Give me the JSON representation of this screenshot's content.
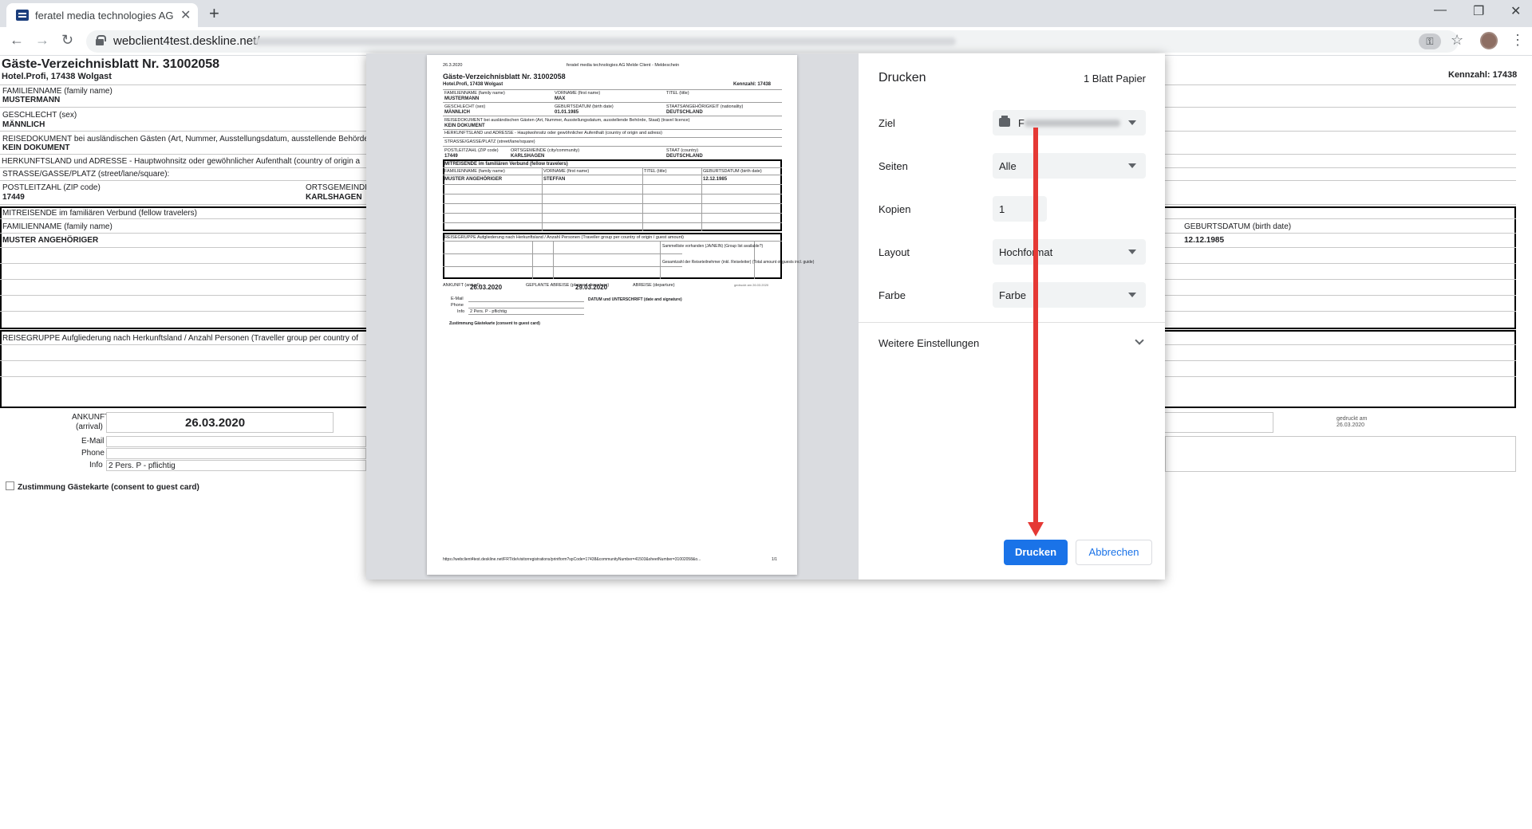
{
  "browser": {
    "tab_title": "feratel media technologies AG M",
    "tab_close": "✕",
    "new_tab": "+",
    "url": "webclient4test.deskline.net/",
    "back": "←",
    "forward": "→",
    "reload": "↻",
    "minimize": "—",
    "restore": "❐",
    "close": "✕",
    "star": "☆",
    "key_icon": "⚿",
    "menu": "⋮"
  },
  "form": {
    "title": "Gäste-Verzeichnisblatt Nr. 31002058",
    "hotel": "Hotel.Profi, 17438 Wolgast",
    "kennzahl": "Kennzahl: 17438",
    "familienname_label": "FAMILIENNAME (family name)",
    "familienname_value": "MUSTERMANN",
    "geschlecht_label": "GESCHLECHT (sex)",
    "geschlecht_value": "MÄNNLICH",
    "reisedokument_label": "REISEDOKUMENT bei ausländischen Gästen (Art, Nummer, Ausstellungsdatum, ausstellende Behörde",
    "reisedokument_value": "KEIN DOKUMENT",
    "herkunft_label": "HERKUNFTSLAND und ADRESSE - Hauptwohnsitz oder gewöhnlicher Aufenthalt (country of origin a",
    "strasse_label": "STRASSE/GASSE/PLATZ (street/lane/square):",
    "plz_label": "POSTLEITZAHL (ZIP code)",
    "plz_value": "17449",
    "ort_label": "ORTSGEMEINDE",
    "ort_value": "KARLSHAGEN",
    "mitreisende_label": "MITREISENDE im familiären Verbund (fellow travelers)",
    "mit_family_label": "FAMILIENNAME (family name)",
    "mit_family_value": "MUSTER ANGEHÖRIGER",
    "geburt_label": "GEBURTSDATUM (birth date)",
    "geburt_value": "12.12.1985",
    "reisegruppe_label": "REISEGRUPPE Aufgliederung nach Herkunftsland / Anzahl Personen (Traveller group per country of",
    "ankunft_label": "ANKUNFT",
    "ankunft_sub": "(arrival)",
    "ankunft_value": "26.03.2020",
    "email_label": "E-Mail",
    "phone_label": "Phone",
    "info_label": "Info",
    "info_value": "2 Pers. P - pflichtig",
    "consent_label": "Zustimmung Gästekarte (consent to guest card)",
    "gedruckt_label": "gedruckt am",
    "gedruckt_value": "26.03.2020"
  },
  "preview": {
    "date": "26.3.2020",
    "header": "feratel media technologies AG Melde Client - Meldeschein",
    "title": "Gäste-Verzeichnisblatt Nr. 31002058",
    "hotel": "Hotel.Profi, 17438 Wolgast",
    "kennzahl": "Kennzahl: 17438",
    "fam_label": "FAMILIENNAME (family name)",
    "fam_value": "MUSTERMANN",
    "vor_label": "VORNAME (first name)",
    "vor_value": "MAX",
    "titel_label": "TITEL (title)",
    "sex_label": "GESCHLECHT (sex)",
    "sex_value": "MÄNNLICH",
    "birth_label": "GEBURTSDATUM (birth date)",
    "birth_value": "01.01.1985",
    "nat_label": "STAATSANGEHÖRIGKEIT (nationality)",
    "nat_value": "DEUTSCHLAND",
    "doc_label": "REISEDOKUMENT bei ausländischen Gästen (Art, Nummer, Ausstellungsdatum, ausstellende Behörde, Staat) (travel licence)",
    "doc_value": "KEIN DOKUMENT",
    "herk_label": "HERKUNFTSLAND und ADRESSE - Hauptwohnsitz oder gewöhnlicher Aufenthalt (country of origin and adress)",
    "str_label": "STRASSE/GASSE/PLATZ (street/lane/square)",
    "plz_label": "POSTLEITZAHL (ZIP code)",
    "plz_value": "17449",
    "ort_label": "ORTSGEMEINDE (city/community)",
    "ort_value": "KARLSHAGEN",
    "staat_label": "STAAT (country)",
    "staat_value": "DEUTSCHLAND",
    "mit_label": "MITREISENDE im familiären Verbund (fellow travelers)",
    "mit_fam_label": "FAMILIENNAME (family name)",
    "mit_vor_label": "VORNAME (first name)",
    "mit_titel_label": "TITEL (title)",
    "mit_birth_label": "GEBURTSDATUM (birth date)",
    "mit_fam_value": "MUSTER ANGEHÖRIGER",
    "mit_vor_value": "STEFFAN",
    "mit_birth_value": "12.12.1985",
    "rg_label": "REISEGRUPPE Aufgliederung nach Herkunftsland / Anzahl Personen (Traveller group per country of origin / guest amount)",
    "rg_sammel": "Sammelliste vorhanden (JA/NEIN) (Group list available?)",
    "rg_gesamt": "Gesamtzahl der Reiseteilnehmer (inkl. Reiseleiter) (Total amount of guests incl. guide)",
    "ank_label": "ANKUNFT (arrival)",
    "ank_value": "26.03.2020",
    "gepl_label": "GEPLANTE ABREISE (planned departure)",
    "gepl_value": "29.03.2020",
    "abr_label": "ABREISE (departure)",
    "gedr": "gedruckt am 26.03.2020",
    "email": "E-Mail",
    "phone": "Phone",
    "info": "Info",
    "info_value": "2 Pers. P - pflichtig",
    "datum_label": "DATUM und UNTERSCHRIFT (date and signature)",
    "consent": "Zustimmung Gästekarte (consent to guest card)",
    "footer_url": "https://webclient4test.deskline.net/FRT/de/visitorregistrations/printform?spCode=17438&communityNumber=41503&sheetNumber=31002058&o...",
    "page_num": "1/1"
  },
  "print": {
    "title": "Drucken",
    "sheets": "1 Blatt Papier",
    "ziel_label": "Ziel",
    "ziel_visible": "F",
    "seiten_label": "Seiten",
    "seiten_value": "Alle",
    "kopien_label": "Kopien",
    "kopien_value": "1",
    "layout_label": "Layout",
    "layout_value": "Hochformat",
    "farbe_label": "Farbe",
    "farbe_value": "Farbe",
    "weitere_label": "Weitere Einstellungen",
    "print_button": "Drucken",
    "cancel_button": "Abbrechen"
  },
  "colors": {
    "accent": "#1a73e8",
    "annotation_arrow": "#e53935"
  }
}
